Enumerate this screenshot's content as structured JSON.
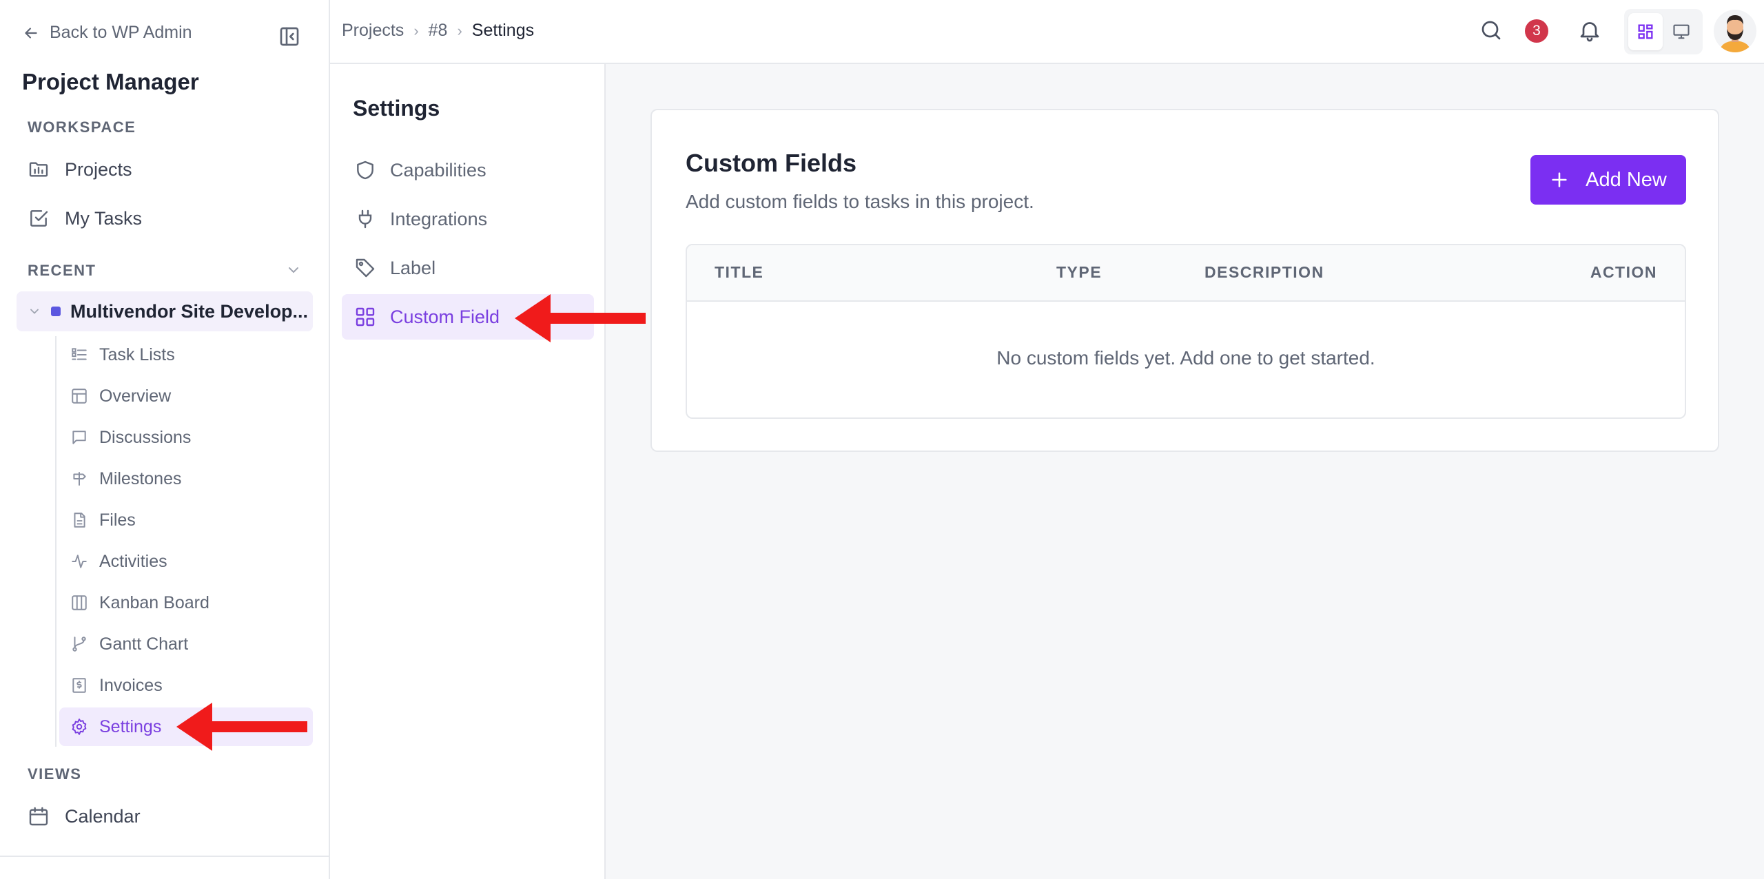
{
  "sidebar": {
    "back_label": "Back to WP Admin",
    "app_title": "Project Manager",
    "workspace_label": "WORKSPACE",
    "workspace_items": [
      {
        "label": "Projects",
        "icon": "folder-icon"
      },
      {
        "label": "My Tasks",
        "icon": "checkbox-icon"
      }
    ],
    "recent_label": "RECENT",
    "project_name": "Multivendor Site Develop...",
    "project_color": "#5b57e0",
    "project_items": [
      {
        "label": "Task Lists",
        "icon": "list-icon"
      },
      {
        "label": "Overview",
        "icon": "layout-icon"
      },
      {
        "label": "Discussions",
        "icon": "chat-icon"
      },
      {
        "label": "Milestones",
        "icon": "signpost-icon"
      },
      {
        "label": "Files",
        "icon": "file-icon"
      },
      {
        "label": "Activities",
        "icon": "activity-icon"
      },
      {
        "label": "Kanban Board",
        "icon": "kanban-icon"
      },
      {
        "label": "Gantt Chart",
        "icon": "git-branch-icon"
      },
      {
        "label": "Invoices",
        "icon": "dollar-file-icon"
      },
      {
        "label": "Settings",
        "icon": "gear-icon",
        "active": true
      }
    ],
    "views_label": "VIEWS",
    "views_items": [
      {
        "label": "Calendar",
        "icon": "calendar-icon"
      }
    ]
  },
  "topbar": {
    "breadcrumb": [
      "Projects",
      "#8",
      "Settings"
    ],
    "notification_count": "3",
    "accent_color": "#7b2ff2"
  },
  "settings_nav": {
    "title": "Settings",
    "items": [
      {
        "label": "Capabilities",
        "icon": "shield-icon"
      },
      {
        "label": "Integrations",
        "icon": "plug-icon"
      },
      {
        "label": "Label",
        "icon": "tag-icon"
      },
      {
        "label": "Custom Field",
        "icon": "grid-icon",
        "active": true
      }
    ]
  },
  "main": {
    "title": "Custom Fields",
    "subtitle": "Add custom fields to tasks in this project.",
    "add_button_label": "Add New",
    "table": {
      "columns": [
        "TITLE",
        "TYPE",
        "DESCRIPTION",
        "ACTION"
      ],
      "rows": [],
      "empty_message": "No custom fields yet. Add one to get started."
    }
  },
  "annotation_color": "#f01b1b"
}
